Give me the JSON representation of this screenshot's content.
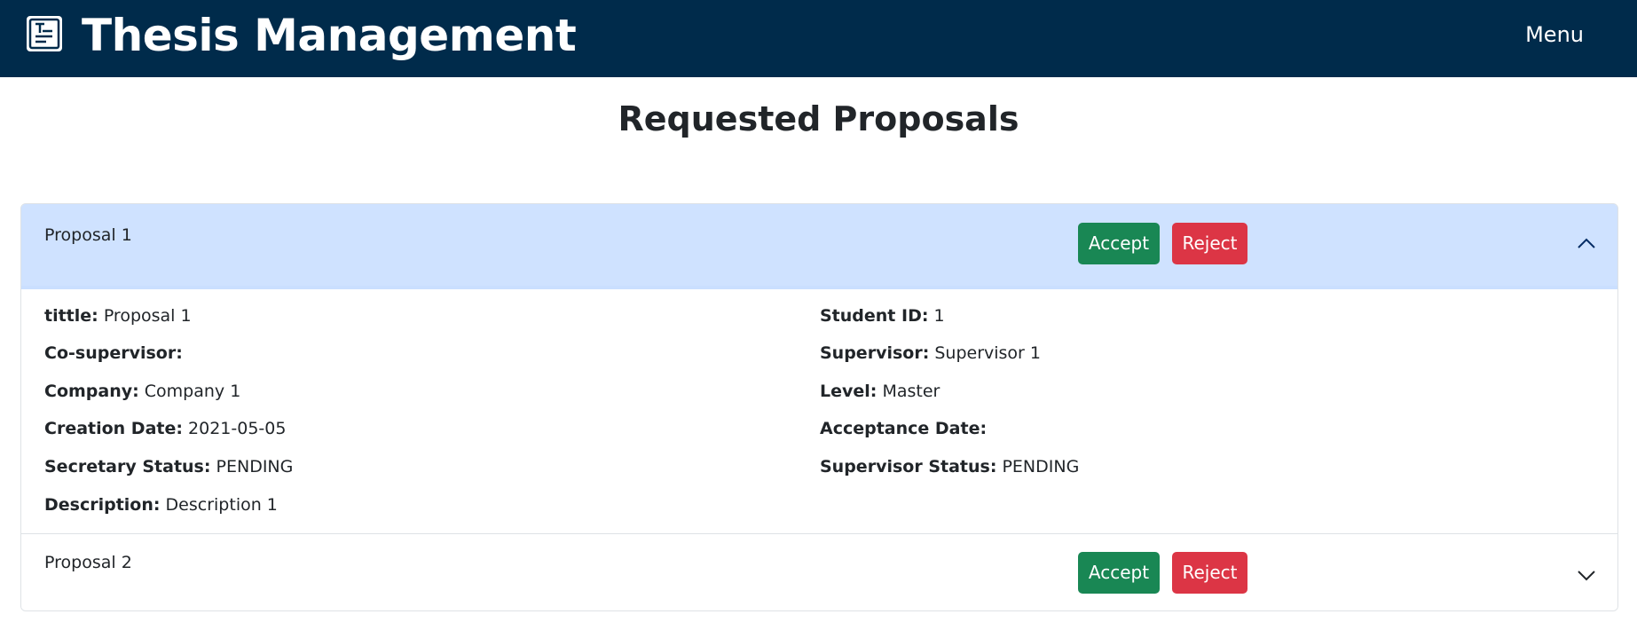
{
  "navbar": {
    "title": "Thesis Management",
    "logo_icon": "thesis-document-icon",
    "menu_label": "Menu",
    "background": "#002b4b"
  },
  "page": {
    "title": "Requested Proposals"
  },
  "proposals": [
    {
      "header": "Proposal 1",
      "expanded": true,
      "accept_label": "Accept",
      "reject_label": "Reject",
      "chevron_icon": "chevron-up-icon",
      "fields": {
        "title_label": "tittle:",
        "title_value": "Proposal 1",
        "student_id_label": "Student ID:",
        "student_id_value": "1",
        "cosupervisor_label": "Co-supervisor:",
        "cosupervisor_value": "",
        "supervisor_label": "Supervisor:",
        "supervisor_value": "Supervisor 1",
        "company_label": "Company:",
        "company_value": "Company 1",
        "level_label": "Level:",
        "level_value": "Master",
        "creation_date_label": "Creation Date:",
        "creation_date_value": "2021-05-05",
        "acceptance_date_label": "Acceptance Date:",
        "acceptance_date_value": "",
        "secretary_status_label": "Secretary Status:",
        "secretary_status_value": "PENDING",
        "supervisor_status_label": "Supervisor Status:",
        "supervisor_status_value": "PENDING",
        "description_label": "Description:",
        "description_value": "Description 1"
      }
    },
    {
      "header": "Proposal 2",
      "expanded": false,
      "accept_label": "Accept",
      "reject_label": "Reject",
      "chevron_icon": "chevron-down-icon"
    }
  ],
  "colors": {
    "accept": "#198754",
    "reject": "#dc3545",
    "active_header": "#cfe2ff"
  }
}
